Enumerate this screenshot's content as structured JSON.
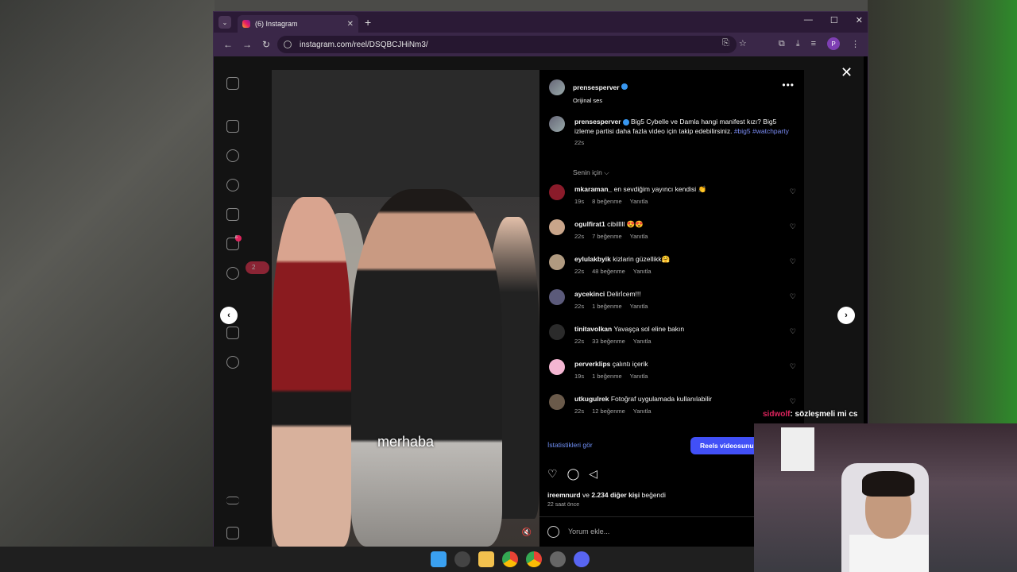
{
  "browser": {
    "tab_title": "(6) Instagram",
    "url": "instagram.com/reel/DSQBCJHiNm3/",
    "profile_initial": "P"
  },
  "sidebar": {
    "notification_count": "6",
    "message_chip": "2"
  },
  "video": {
    "subtitle": "merhaba"
  },
  "post": {
    "author": "prensesperver",
    "audio": "Orijinal ses",
    "caption_author": "prensesperver",
    "caption_text": "Big5 Cybelle ve Damla hangi manifest kızı? Big5 izleme partisi daha fazla video için takip edebilirsiniz.",
    "hashtag1": "#big5",
    "hashtag2": "#watchparty",
    "caption_time": "22s",
    "sort_label": "Senin için ⌵",
    "reply_label": "Yanıtla",
    "comments": [
      {
        "user": "mkaraman_",
        "text": "en sevdiğim yayıncı kendisi 👏",
        "time": "19s",
        "likes": "8 beğenme",
        "color": "#8a1b2a"
      },
      {
        "user": "ogulfirat1",
        "text": "cibilllll 😍😍",
        "time": "22s",
        "likes": "7 beğenme",
        "color": "#c9a58a"
      },
      {
        "user": "eylulakbyik",
        "text": "kizlarin güzellikk🤗",
        "time": "22s",
        "likes": "48 beğenme",
        "color": "#b09a80"
      },
      {
        "user": "aycekinci",
        "text": "Delirİcem!!!",
        "time": "22s",
        "likes": "1 beğenme",
        "color": "#5b5a7a"
      },
      {
        "user": "tinitavolkan",
        "text": "Yavaşça sol eline bakın",
        "time": "22s",
        "likes": "33 beğenme",
        "color": "#2b2b2b"
      },
      {
        "user": "perverklips",
        "text": "çalıntı içerik",
        "time": "19s",
        "likes": "1 beğenme",
        "color": "#f4b6d2"
      },
      {
        "user": "utkugulrek",
        "text": "Fotoğraf uygulamada kullanılabilir",
        "time": "22s",
        "likes": "12 beğenme",
        "color": "#6a5a4a"
      }
    ],
    "stats_link": "İstatistikleri gör",
    "reels_button": "Reels videosunu",
    "likes_user": "ireemnurd",
    "likes_connector": "ve",
    "likes_others": "2.234 diğer kişi",
    "likes_suffix": "beğendi",
    "posted_ago": "22 saat önce",
    "comment_placeholder": "Yorum ekle..."
  },
  "stream_chat": {
    "user": "sidwolf",
    "message": ": sözleşmeli mi cs"
  }
}
